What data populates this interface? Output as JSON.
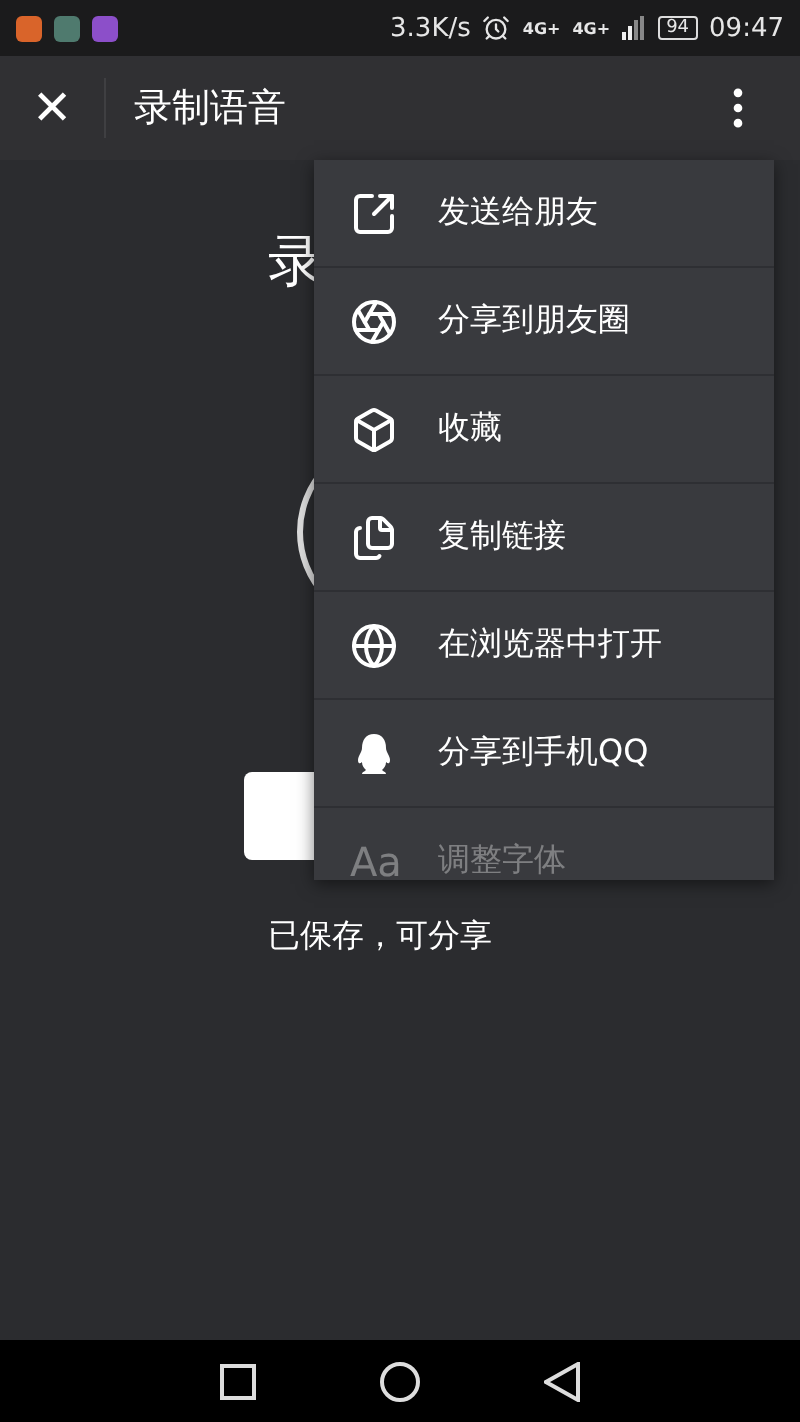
{
  "status_bar": {
    "speed": "3.3K/s",
    "network": [
      "4G+",
      "4G+"
    ],
    "battery": "94",
    "time": "09:47"
  },
  "header": {
    "close": "✕",
    "title": "录制语音"
  },
  "page": {
    "heading": "录",
    "saved_text": "已保存，可分享"
  },
  "menu": [
    {
      "kind": "send",
      "label": "发送给朋友",
      "faded": false
    },
    {
      "kind": "moments",
      "label": "分享到朋友圈",
      "faded": false
    },
    {
      "kind": "favorite",
      "label": "收藏",
      "faded": false
    },
    {
      "kind": "copy",
      "label": "复制链接",
      "faded": false
    },
    {
      "kind": "browser",
      "label": "在浏览器中打开",
      "faded": false
    },
    {
      "kind": "qq",
      "label": "分享到手机QQ",
      "faded": false
    },
    {
      "kind": "font",
      "glyph": "Aa",
      "label": "调整字体",
      "faded": true
    }
  ]
}
